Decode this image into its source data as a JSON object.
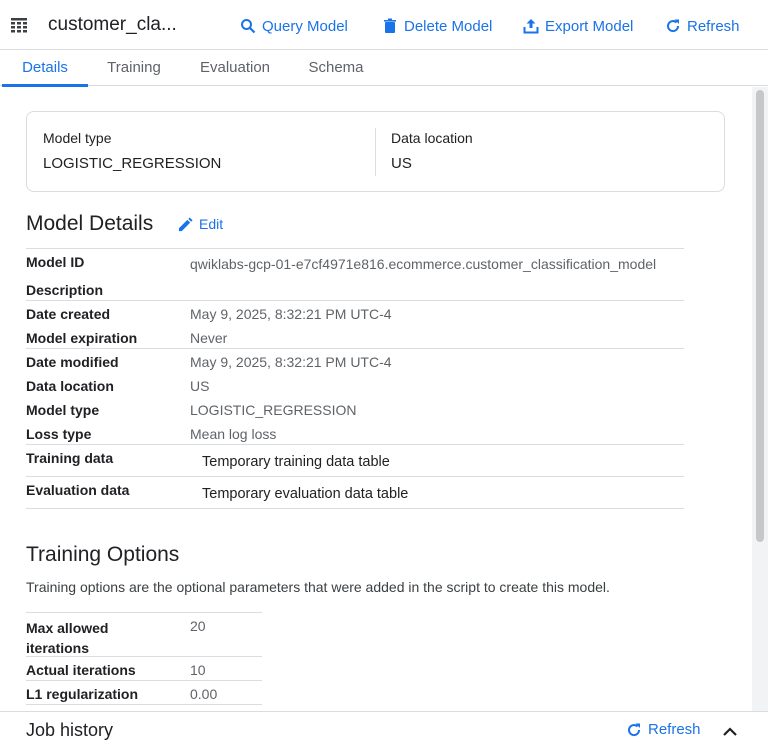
{
  "header": {
    "model_name": "customer_cla...",
    "actions": {
      "query": "Query Model",
      "delete": "Delete Model",
      "export": "Export Model",
      "refresh": "Refresh"
    }
  },
  "tabs": [
    {
      "label": "Details",
      "active": true
    },
    {
      "label": "Training",
      "active": false
    },
    {
      "label": "Evaluation",
      "active": false
    },
    {
      "label": "Schema",
      "active": false
    }
  ],
  "summary": {
    "model_type_label": "Model type",
    "model_type_value": "LOGISTIC_REGRESSION",
    "data_location_label": "Data location",
    "data_location_value": "US"
  },
  "model_details": {
    "title": "Model Details",
    "edit_label": "Edit",
    "rows": [
      {
        "key": "Model ID",
        "value": "qwiklabs-gcp-01-e7cf4971e816.ecommerce.customer_classification_model"
      },
      {
        "key": "Description",
        "value": ""
      },
      {
        "key": "Date created",
        "value": "May 9, 2025, 8:32:21 PM UTC-4"
      },
      {
        "key": "Model expiration",
        "value": "Never"
      },
      {
        "key": "Date modified",
        "value": "May 9, 2025, 8:32:21 PM UTC-4"
      },
      {
        "key": "Data location",
        "value": "US"
      },
      {
        "key": "Model type",
        "value": "LOGISTIC_REGRESSION"
      },
      {
        "key": "Loss type",
        "value": "Mean log loss"
      },
      {
        "key": "Training data",
        "value": "Temporary training data table"
      },
      {
        "key": "Evaluation data",
        "value": "Temporary evaluation data table"
      }
    ]
  },
  "training_options": {
    "title": "Training Options",
    "description": "Training options are the optional parameters that were added in the script to create this model.",
    "rows": [
      {
        "key": "Max allowed iterations",
        "value": "20"
      },
      {
        "key": "Actual iterations",
        "value": "10"
      },
      {
        "key": "L1 regularization",
        "value": "0.00"
      }
    ]
  },
  "job_history": {
    "title": "Job history",
    "refresh_label": "Refresh"
  },
  "colors": {
    "accent": "#1a73e8",
    "text": "#202124",
    "muted": "#5f6368",
    "border": "#dadce0"
  }
}
